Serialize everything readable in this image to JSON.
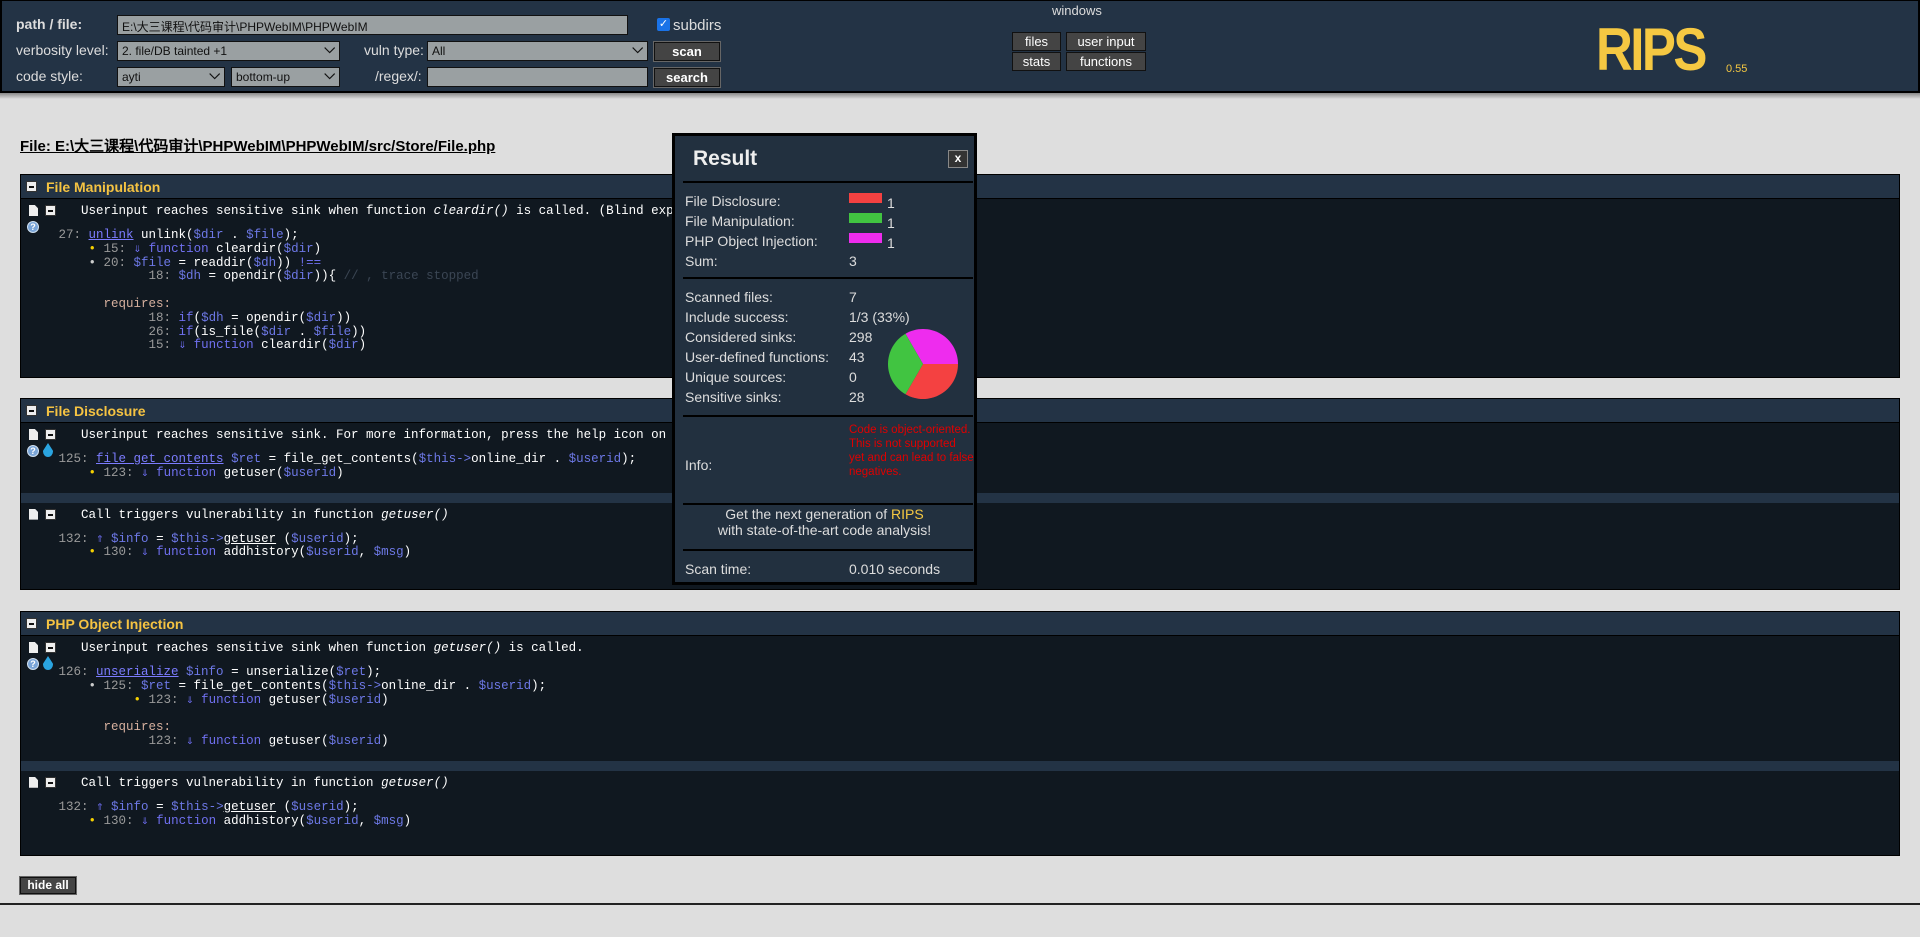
{
  "header": {
    "path_label": "path / file:",
    "path_value": "E:\\大三课程\\代码审计\\PHPWebIM\\PHPWebIM",
    "subdirs_label": "subdirs",
    "subdirs_checked": true,
    "verbosity_label": "verbosity level:",
    "verbosity_value": "2. file/DB tainted +1",
    "vuln_label": "vuln type:",
    "vuln_value": "All",
    "scan_label": "scan",
    "code_style_label": "code style:",
    "code_style_value": "ayti",
    "order_value": "bottom-up",
    "regex_label": "/regex/:",
    "regex_value": "",
    "search_label": "search",
    "windows_label": "windows",
    "windows_buttons": [
      "files",
      "user input",
      "stats",
      "functions"
    ],
    "logo_text": "RIPS",
    "version": "0.55"
  },
  "file_title": "File: E:\\大三课程\\代码审计\\PHPWebIM\\PHPWebIM/src/Store/File.php",
  "sections": [
    {
      "title": "File Manipulation",
      "entries": [
        {
          "desc": [
            "Userinput reaches sensitive sink when function ",
            {
              "i": "cleardir()"
            },
            " is called. (Blind exploitation)"
          ],
          "help": true,
          "drop": false,
          "lines": [
            [
              [
                "num",
                "     27: "
              ],
              [
                "sink",
                "unlink"
              ],
              [
                "plain",
                " unlink("
              ],
              [
                "var",
                "$dir"
              ],
              [
                "plain",
                " . "
              ],
              [
                "var",
                "$file"
              ],
              [
                "plain",
                ");"
              ]
            ],
            [
              [
                "bullet",
                "         • "
              ],
              [
                "num",
                "15: "
              ],
              [
                "arrow",
                "⇓ "
              ],
              [
                "kw",
                "function"
              ],
              [
                "plain",
                " cleardir("
              ],
              [
                "var",
                "$dir"
              ],
              [
                "plain",
                ")"
              ]
            ],
            [
              [
                "bullet2",
                "         • "
              ],
              [
                "num",
                "20: "
              ],
              [
                "var",
                "$file"
              ],
              [
                "plain",
                " = readdir("
              ],
              [
                "var",
                "$dh"
              ],
              [
                "plain",
                ")) "
              ],
              [
                "kw",
                "!=="
              ]
            ],
            [
              [
                "num",
                "                 18: "
              ],
              [
                "var",
                "$dh"
              ],
              [
                "plain",
                " = opendir("
              ],
              [
                "var",
                "$dir"
              ],
              [
                "plain",
                "))"
              ],
              [
                "plain",
                "{ "
              ],
              [
                "com",
                "// , trace stopped"
              ]
            ],
            [
              [
                "plain",
                " "
              ]
            ],
            [
              [
                "req",
                "           requires:"
              ]
            ],
            [
              [
                "num",
                "                 18: "
              ],
              [
                "kw",
                "if"
              ],
              [
                "plain",
                "("
              ],
              [
                "var",
                "$dh"
              ],
              [
                "plain",
                " = opendir("
              ],
              [
                "var",
                "$dir"
              ],
              [
                "plain",
                "))"
              ]
            ],
            [
              [
                "num",
                "                 26: "
              ],
              [
                "kw",
                "if"
              ],
              [
                "plain",
                "(is_file("
              ],
              [
                "var",
                "$dir"
              ],
              [
                "plain",
                " . "
              ],
              [
                "var",
                "$file"
              ],
              [
                "plain",
                "))"
              ]
            ],
            [
              [
                "num",
                "                 15: "
              ],
              [
                "arrow",
                "⇓ "
              ],
              [
                "kw",
                "function"
              ],
              [
                "plain",
                " cleardir("
              ],
              [
                "var",
                "$dir"
              ],
              [
                "plain",
                ")"
              ]
            ]
          ]
        }
      ]
    },
    {
      "title": "File Disclosure",
      "entries": [
        {
          "desc": [
            "Userinput reaches sensitive sink. For more information, press the help icon on the left side."
          ],
          "help": true,
          "drop": true,
          "lines": [
            [
              [
                "num",
                "     125: "
              ],
              [
                "sink",
                "file_get_contents"
              ],
              [
                "plain",
                " "
              ],
              [
                "var",
                "$ret"
              ],
              [
                "plain",
                " = file_get_contents("
              ],
              [
                "var",
                "$this->"
              ],
              [
                "plain",
                "online_dir . "
              ],
              [
                "var",
                "$userid"
              ],
              [
                "plain",
                ");"
              ]
            ],
            [
              [
                "bullet",
                "         • "
              ],
              [
                "num",
                "123: "
              ],
              [
                "arrow",
                "⇓ "
              ],
              [
                "kw",
                "function"
              ],
              [
                "plain",
                " getuser("
              ],
              [
                "var",
                "$userid"
              ],
              [
                "plain",
                ")"
              ]
            ]
          ]
        },
        {
          "desc": [
            "Call triggers vulnerability in function ",
            {
              "i": "getuser()"
            }
          ],
          "help": false,
          "drop": false,
          "lines": [
            [
              [
                "num",
                "     132: "
              ],
              [
                "arrow",
                "⇑ "
              ],
              [
                "var",
                "$info"
              ],
              [
                "plain",
                " = "
              ],
              [
                "var",
                "$this->"
              ],
              [
                "call",
                "getuser"
              ],
              [
                "plain",
                " ("
              ],
              [
                "var",
                "$userid"
              ],
              [
                "plain",
                ");"
              ]
            ],
            [
              [
                "bullet",
                "         • "
              ],
              [
                "num",
                "130: "
              ],
              [
                "arrow",
                "⇓ "
              ],
              [
                "kw",
                "function"
              ],
              [
                "plain",
                " addhistory("
              ],
              [
                "var",
                "$userid"
              ],
              [
                "plain",
                ", "
              ],
              [
                "var",
                "$msg"
              ],
              [
                "plain",
                ")"
              ]
            ]
          ]
        }
      ]
    },
    {
      "title": "PHP Object Injection",
      "entries": [
        {
          "desc": [
            "Userinput reaches sensitive sink when function ",
            {
              "i": "getuser()"
            },
            " is called."
          ],
          "help": true,
          "drop": true,
          "lines": [
            [
              [
                "num",
                "     126: "
              ],
              [
                "sink",
                "unserialize"
              ],
              [
                "plain",
                " "
              ],
              [
                "var",
                "$info"
              ],
              [
                "plain",
                " = unserialize("
              ],
              [
                "var",
                "$ret"
              ],
              [
                "plain",
                ");"
              ]
            ],
            [
              [
                "bullet2",
                "         • "
              ],
              [
                "num",
                "125: "
              ],
              [
                "var",
                "$ret"
              ],
              [
                "plain",
                " = file_get_contents("
              ],
              [
                "var",
                "$this->"
              ],
              [
                "plain",
                "online_dir . "
              ],
              [
                "var",
                "$userid"
              ],
              [
                "plain",
                ");"
              ]
            ],
            [
              [
                "bullet",
                "               • "
              ],
              [
                "num",
                "123: "
              ],
              [
                "arrow",
                "⇓ "
              ],
              [
                "kw",
                "function"
              ],
              [
                "plain",
                " getuser("
              ],
              [
                "var",
                "$userid"
              ],
              [
                "plain",
                ")"
              ]
            ],
            [
              [
                "plain",
                " "
              ]
            ],
            [
              [
                "req",
                "           requires:"
              ]
            ],
            [
              [
                "num",
                "                 123: "
              ],
              [
                "arrow",
                "⇓ "
              ],
              [
                "kw",
                "function"
              ],
              [
                "plain",
                " getuser("
              ],
              [
                "var",
                "$userid"
              ],
              [
                "plain",
                ")"
              ]
            ]
          ]
        },
        {
          "desc": [
            "Call triggers vulnerability in function ",
            {
              "i": "getuser()"
            }
          ],
          "help": false,
          "drop": false,
          "lines": [
            [
              [
                "num",
                "     132: "
              ],
              [
                "arrow",
                "⇑ "
              ],
              [
                "var",
                "$info"
              ],
              [
                "plain",
                " = "
              ],
              [
                "var",
                "$this->"
              ],
              [
                "call",
                "getuser"
              ],
              [
                "plain",
                " ("
              ],
              [
                "var",
                "$userid"
              ],
              [
                "plain",
                ");"
              ]
            ],
            [
              [
                "bullet",
                "         • "
              ],
              [
                "num",
                "130: "
              ],
              [
                "arrow",
                "⇓ "
              ],
              [
                "kw",
                "function"
              ],
              [
                "plain",
                " addhistory("
              ],
              [
                "var",
                "$userid"
              ],
              [
                "plain",
                ", "
              ],
              [
                "var",
                "$msg"
              ],
              [
                "plain",
                ")"
              ]
            ]
          ]
        }
      ]
    }
  ],
  "hide_all_label": "hide all",
  "result": {
    "title": "Result",
    "close_label": "x",
    "vulns": [
      {
        "label": "File Disclosure:",
        "count": "1",
        "color": "#f44141"
      },
      {
        "label": "File Manipulation:",
        "count": "1",
        "color": "#41c441"
      },
      {
        "label": "PHP Object Injection:",
        "count": "1",
        "color": "#ee2cee"
      }
    ],
    "sum_label": "Sum:",
    "sum_value": "3",
    "stats": [
      {
        "label": "Scanned files:",
        "value": "7"
      },
      {
        "label": "Include success:",
        "value": "1/3 (33%)"
      },
      {
        "label": "Considered sinks:",
        "value": "298"
      },
      {
        "label": "User-defined functions:",
        "value": "43"
      },
      {
        "label": "Unique sources:",
        "value": "0"
      },
      {
        "label": "Sensitive sinks:",
        "value": "28"
      }
    ],
    "info_label": "Info:",
    "info_text": "Code is object-oriented. This is not supported yet and can lead to false negatives.",
    "promo_line1": "Get the next generation of ",
    "promo_brand": "RIPS",
    "promo_line2": "with state-of-the-art code analysis!",
    "scan_time_label": "Scan time:",
    "scan_time_value": "0.010 seconds"
  }
}
